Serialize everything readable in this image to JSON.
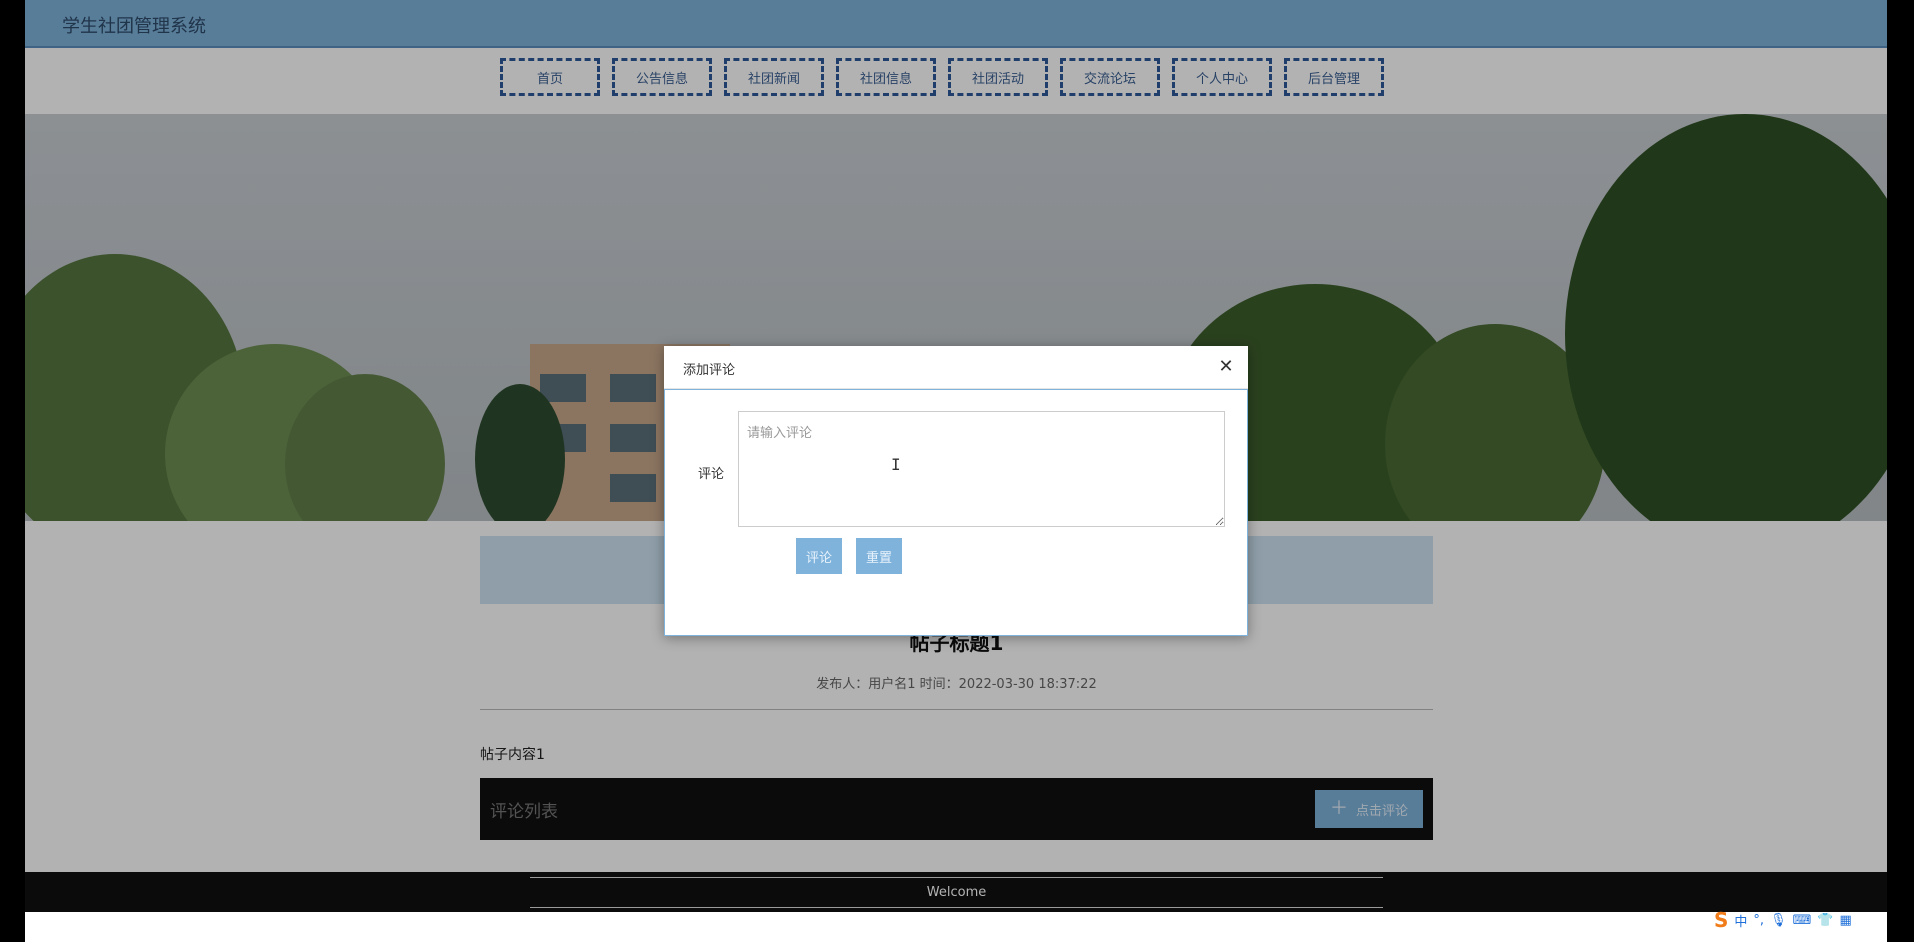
{
  "site": {
    "title": "学生社团管理系统"
  },
  "nav": {
    "items": [
      {
        "label": "首页"
      },
      {
        "label": "公告信息"
      },
      {
        "label": "社团新闻"
      },
      {
        "label": "社团信息"
      },
      {
        "label": "社团活动"
      },
      {
        "label": "交流论坛"
      },
      {
        "label": "个人中心"
      },
      {
        "label": "后台管理"
      }
    ]
  },
  "post": {
    "title": "帖子标题1",
    "meta": "发布人：用户名1 时间：2022-03-30 18:37:22",
    "content": "帖子内容1"
  },
  "comments": {
    "title": "评论列表",
    "add_button_label": "点击评论",
    "add_button_icon": "plus-icon"
  },
  "footer": {
    "text": "Welcome"
  },
  "dialog": {
    "title": "添加评论",
    "close_icon": "close-icon",
    "field_label": "评论",
    "input_placeholder": "请输入评论",
    "input_value": "",
    "submit_label": "评论",
    "reset_label": "重置"
  },
  "tray": {
    "ime_lang": "中",
    "icons": [
      "sogou-icon",
      "punctuation-icon",
      "microphone-icon",
      "keyboard-icon",
      "skin-icon",
      "apps-icon"
    ]
  },
  "colors": {
    "accent": "#7fb3dc",
    "nav_border": "#2f5a9a",
    "footer_bg": "#111111",
    "comments_bar_bg": "#111111"
  }
}
